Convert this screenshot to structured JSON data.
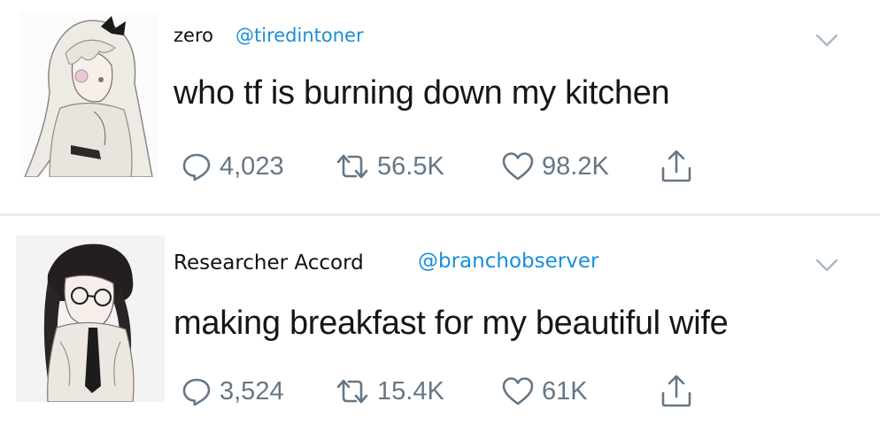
{
  "tweets": [
    {
      "display_name": "zero",
      "handle": "@tiredintoner",
      "text": "who tf is burning down my kitchen",
      "replies": "4,023",
      "retweets": "56.5K",
      "likes": "98.2K",
      "icons": {
        "menu": "chevron-down-icon",
        "reply": "reply-icon",
        "retweet": "retweet-icon",
        "like": "heart-icon",
        "share": "share-icon"
      }
    },
    {
      "display_name": "Researcher Accord",
      "handle": "@branchobserver",
      "text": "making breakfast for my beautiful wife",
      "replies": "3,524",
      "retweets": "15.4K",
      "likes": "61K",
      "icons": {
        "menu": "chevron-down-icon",
        "reply": "reply-icon",
        "retweet": "retweet-icon",
        "like": "heart-icon",
        "share": "share-icon"
      }
    }
  ],
  "colors": {
    "handle": "#1b8fd6",
    "text": "#14171a",
    "icon_gray": "#657786",
    "divider": "#e6ecf0"
  }
}
